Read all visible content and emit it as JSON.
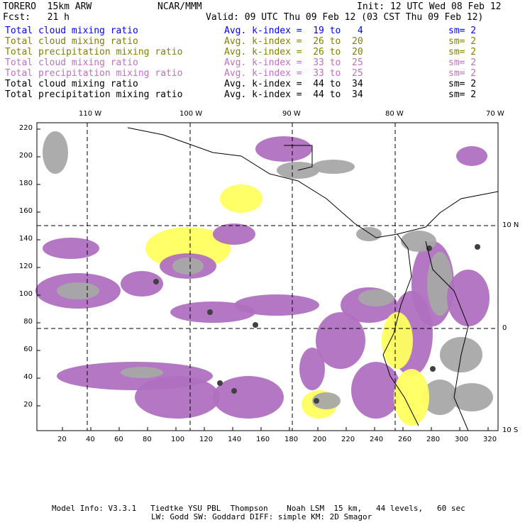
{
  "header": {
    "model": "TORERO  15km ARW",
    "org": "NCAR/MMM",
    "init": "Init: 12 UTC Wed 08 Feb 12",
    "fcst": "Fcst:   21 h",
    "valid": "Valid: 09 UTC Thu 09 Feb 12 (03 CST Thu 09 Feb 12)"
  },
  "legend": [
    {
      "field": "Total cloud mixing ratio",
      "kindex": "Avg. k-index =  19 to   4",
      "sm": "sm= 2",
      "color": "#0000ff"
    },
    {
      "field": "Total cloud mixing ratio",
      "kindex": "Avg. k-index =  26 to  20",
      "sm": "sm= 2",
      "color": "#808000"
    },
    {
      "field": "Total precipitation mixing ratio",
      "kindex": "Avg. k-index =  26 to  20",
      "sm": "sm= 2",
      "color": "#808000"
    },
    {
      "field": "Total cloud mixing ratio",
      "kindex": "Avg. k-index =  33 to  25",
      "sm": "sm= 2",
      "color": "#c070c0"
    },
    {
      "field": "Total precipitation mixing ratio",
      "kindex": "Avg. k-index =  33 to  25",
      "sm": "sm= 2",
      "color": "#c070c0"
    },
    {
      "field": "Total cloud mixing ratio",
      "kindex": "Avg. k-index =  44 to  34",
      "sm": "sm= 2",
      "color": "#000000"
    },
    {
      "field": "Total precipitation mixing ratio",
      "kindex": "Avg. k-index =  44 to  34",
      "sm": "sm= 2",
      "color": "#000000"
    }
  ],
  "map": {
    "lon_labels": [
      "110 W",
      "100 W",
      "90 W",
      "80 W",
      "70 W"
    ],
    "lat_labels": [
      "10 N",
      "0",
      "10 S"
    ],
    "x_ticks": [
      "20",
      "40",
      "60",
      "80",
      "100",
      "120",
      "140",
      "160",
      "180",
      "200",
      "220",
      "240",
      "260",
      "280",
      "300",
      "320"
    ],
    "y_ticks": [
      "20",
      "40",
      "60",
      "80",
      "100",
      "120",
      "140",
      "160",
      "180",
      "200",
      "220"
    ],
    "colors": {
      "yellow": "#ffff60",
      "purple": "#b070c0",
      "gray": "#a8a8a8",
      "dark": "#404040"
    }
  },
  "footer": {
    "line1": "Model Info: V3.3.1   Tiedtke YSU PBL  Thompson    Noah LSM  15 km,   44 levels,   60 sec",
    "line2": "LW: Godd SW: Goddard DIFF: simple KM: 2D Smagor"
  }
}
